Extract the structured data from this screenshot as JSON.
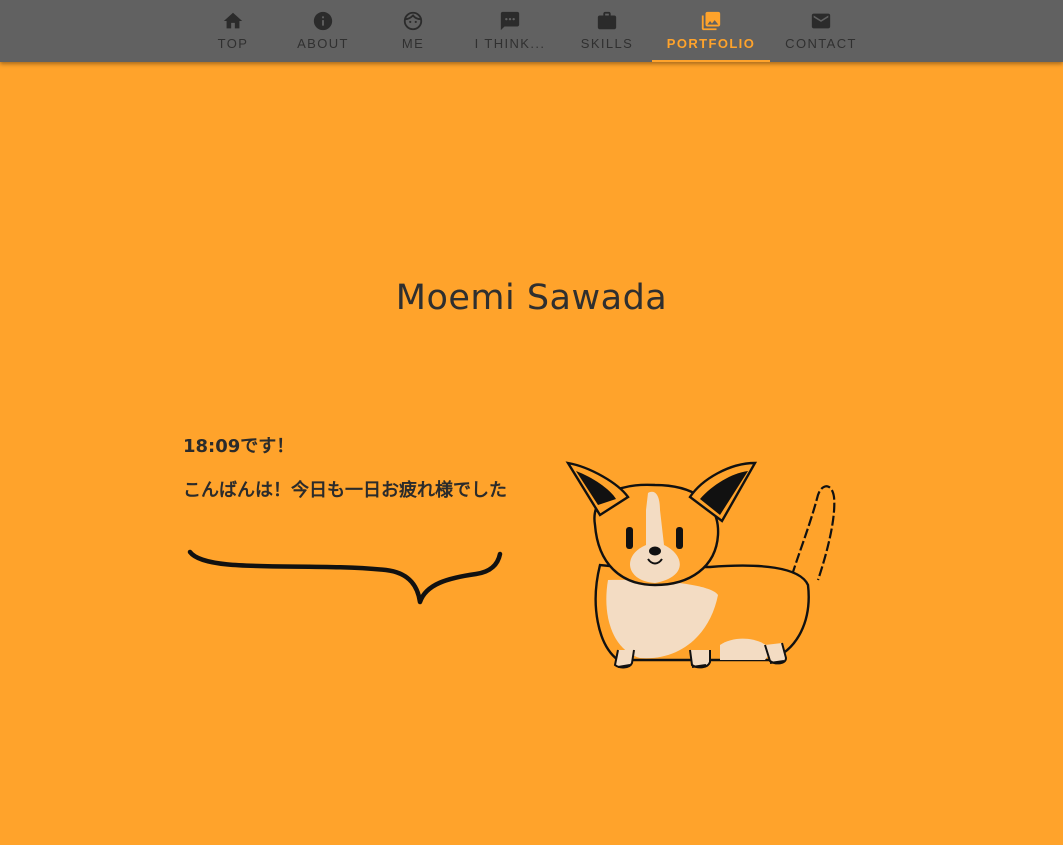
{
  "nav": {
    "items": [
      {
        "label": "TOP",
        "icon": "home-icon"
      },
      {
        "label": "ABOUT",
        "icon": "info-icon"
      },
      {
        "label": "ME",
        "icon": "face-icon"
      },
      {
        "label": "I THINK...",
        "icon": "chat-icon"
      },
      {
        "label": "SKILLS",
        "icon": "briefcase-icon"
      },
      {
        "label": "PORTFOLIO",
        "icon": "photo-library-icon",
        "active": true
      },
      {
        "label": "CONTACT",
        "icon": "mail-icon"
      }
    ]
  },
  "main": {
    "title": "Moemi Sawada",
    "time_message": "18:09です！",
    "greeting": "こんばんは！今日も一日お疲れ様でした"
  },
  "colors": {
    "background": "#ffa32b",
    "navbar": "#616161",
    "accent": "#ffa32b",
    "text": "#2f2f2f"
  }
}
